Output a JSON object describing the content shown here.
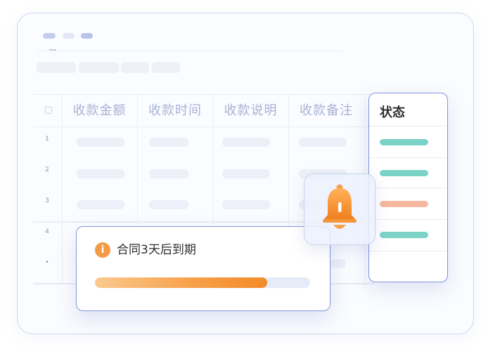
{
  "table": {
    "headers": [
      "收款金额",
      "收款时间",
      "收款说明",
      "收款备注"
    ],
    "row_numbers": [
      "1",
      "2",
      "3",
      "4",
      "•"
    ]
  },
  "status_panel": {
    "title": "状态",
    "status_colors": [
      "#7bd3c8",
      "#7bd3c8",
      "#f7b8a0",
      "#7bd3c8"
    ]
  },
  "alert": {
    "icon": "info-icon",
    "icon_glyph": "i",
    "message": "合同3天后到期",
    "progress": 0.8
  },
  "bell": {
    "icon": "bell-icon"
  },
  "colors": {
    "accent_border": "#7e93e0",
    "warning_orange": "#f59b46",
    "header_text": "#aab1d6"
  }
}
